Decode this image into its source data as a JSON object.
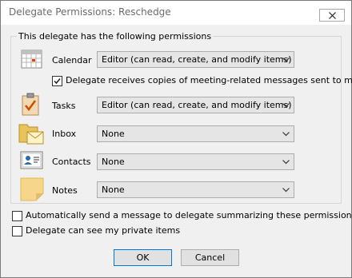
{
  "window": {
    "title": "Delegate Permissions: Reschedge"
  },
  "group": {
    "label": "This delegate has the following permissions"
  },
  "rows": {
    "calendar": {
      "label": "Calendar",
      "value": "Editor (can read, create, and modify items)"
    },
    "tasks": {
      "label": "Tasks",
      "value": "Editor (can read, create, and modify items)"
    },
    "inbox": {
      "label": "Inbox",
      "value": "None"
    },
    "contacts": {
      "label": "Contacts",
      "value": "None"
    },
    "notes": {
      "label": "Notes",
      "value": "None"
    }
  },
  "checkboxes": {
    "meeting_copies": {
      "label": "Delegate receives copies of meeting-related messages sent to me",
      "checked": true
    },
    "auto_send": {
      "label": "Automatically send a message to delegate summarizing these permissions",
      "checked": false
    },
    "private_items": {
      "label": "Delegate can see my private items",
      "checked": false
    }
  },
  "buttons": {
    "ok": "OK",
    "cancel": "Cancel"
  },
  "icons": [
    "calendar-icon",
    "tasks-icon",
    "inbox-icon",
    "contacts-icon",
    "notes-icon",
    "close-icon",
    "chevron-down-icon",
    "checkmark-icon"
  ]
}
